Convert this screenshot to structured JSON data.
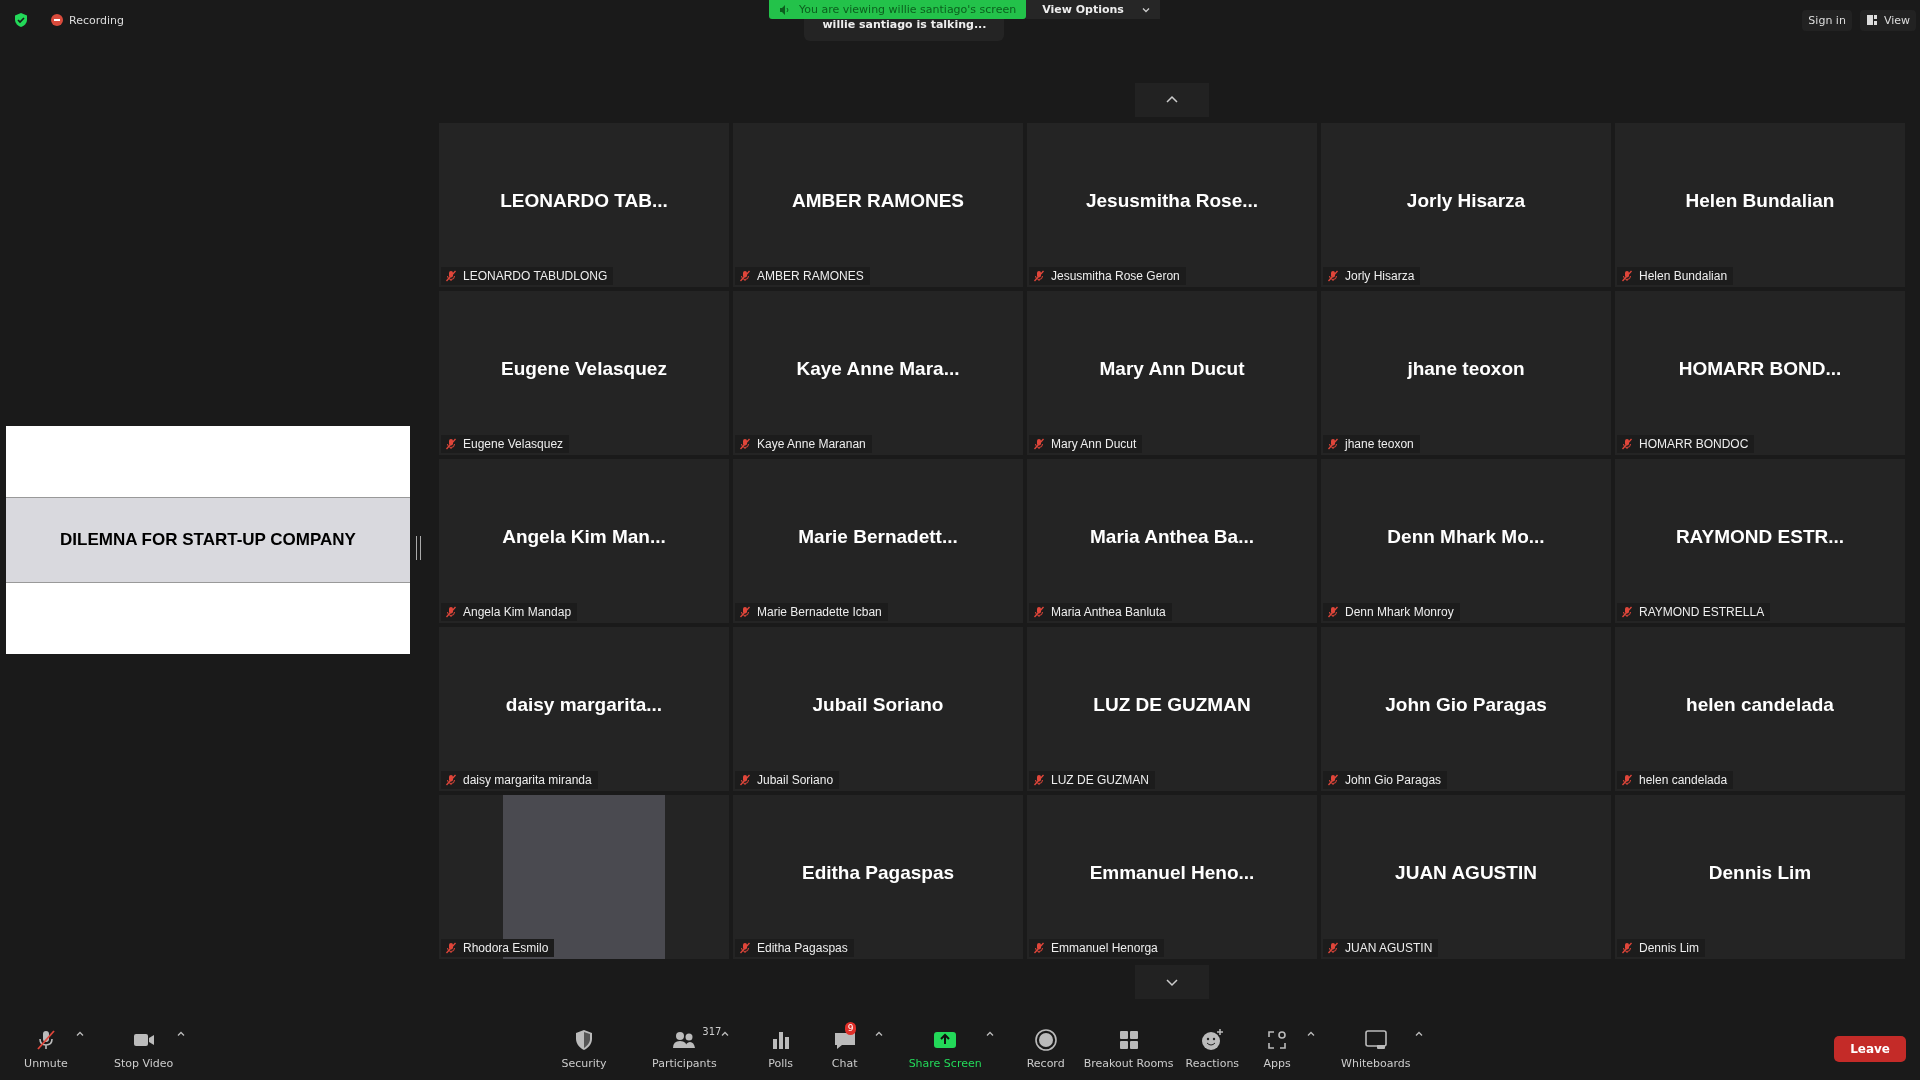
{
  "top_bar": {
    "recording_label": "Recording",
    "banner": "You are viewing willie santiago's screen",
    "view_options": "View Options",
    "talking": "willie santiago is talking...",
    "sign_in": "Sign in",
    "view": "View"
  },
  "shared_screen": {
    "title": "DILEMNA FOR START-UP COMPANY"
  },
  "tile_rows": [
    {
      "tiles": [
        {
          "kind": "name",
          "display": "LEONARDO TAB...",
          "label": "LEONARDO TABUDLONG",
          "muted": true
        },
        {
          "kind": "name",
          "display": "AMBER RAMONES",
          "label": "AMBER RAMONES",
          "muted": true
        },
        {
          "kind": "name",
          "display": "Jesusmitha Rose...",
          "label": "Jesusmitha Rose Geron",
          "muted": true
        },
        {
          "kind": "name",
          "display": "Jorly Hisarza",
          "label": "Jorly Hisarza",
          "muted": true
        },
        {
          "kind": "name",
          "display": "Helen Bundalian",
          "label": "Helen Bundalian",
          "muted": true
        }
      ]
    },
    {
      "tiles": [
        {
          "kind": "name",
          "display": "Eugene Velasquez",
          "label": "Eugene Velasquez",
          "muted": true
        },
        {
          "kind": "name",
          "display": "Kaye Anne Mara...",
          "label": "Kaye Anne Maranan",
          "muted": true
        },
        {
          "kind": "name",
          "display": "Mary Ann Ducut",
          "label": "Mary Ann Ducut",
          "muted": true
        },
        {
          "kind": "name",
          "display": "jhane teoxon",
          "label": "jhane teoxon",
          "muted": true
        },
        {
          "kind": "name",
          "display": "HOMARR BOND...",
          "label": "HOMARR BONDOC",
          "muted": true
        }
      ]
    },
    {
      "tiles": [
        {
          "kind": "name",
          "display": "Angela Kim Man...",
          "label": "Angela Kim Mandap",
          "muted": true
        },
        {
          "kind": "name",
          "display": "Marie Bernadett...",
          "label": "Marie Bernadette Icban",
          "muted": true
        },
        {
          "kind": "name",
          "display": "Maria Anthea Ba...",
          "label": "Maria Anthea Banluta",
          "muted": true
        },
        {
          "kind": "name",
          "display": "Denn Mhark Mo...",
          "label": "Denn Mhark Monroy",
          "muted": true
        },
        {
          "kind": "name",
          "display": "RAYMOND ESTR...",
          "label": "RAYMOND ESTRELLA",
          "muted": true
        }
      ]
    },
    {
      "tiles": [
        {
          "kind": "name",
          "display": "daisy margarita...",
          "label": "daisy margarita miranda",
          "muted": true
        },
        {
          "kind": "name",
          "display": "Jubail Soriano",
          "label": "Jubail Soriano",
          "muted": true
        },
        {
          "kind": "name",
          "display": "LUZ DE GUZMAN",
          "label": "LUZ DE GUZMAN",
          "muted": true
        },
        {
          "kind": "name",
          "display": "John Gio Paragas",
          "label": "John Gio Paragas",
          "muted": true
        },
        {
          "kind": "name",
          "display": "helen candelada",
          "label": "helen candelada",
          "muted": true
        }
      ]
    },
    {
      "tiles": [
        {
          "kind": "video",
          "label": "Rhodora Esmilo",
          "muted": true
        },
        {
          "kind": "name",
          "display": "Editha Pagaspas",
          "label": "Editha Pagaspas",
          "muted": true
        },
        {
          "kind": "name",
          "display": "Emmanuel Heno...",
          "label": "Emmanuel Henorga",
          "muted": true
        },
        {
          "kind": "name",
          "display": "JUAN AGUSTIN",
          "label": "JUAN AGUSTIN",
          "muted": true
        },
        {
          "kind": "name",
          "display": "Dennis Lim",
          "label": "Dennis Lim",
          "muted": true
        }
      ]
    }
  ],
  "toolbar": {
    "left": [
      {
        "kind": "mic",
        "label": "Unmute",
        "menu": true
      },
      {
        "kind": "video",
        "label": "Stop Video",
        "menu": true
      }
    ],
    "center": [
      {
        "kind": "security",
        "label": "Security",
        "menu": false
      },
      {
        "kind": "participants",
        "label": "Participants",
        "count": "317",
        "menu": true
      },
      {
        "kind": "polls",
        "label": "Polls",
        "menu": false
      },
      {
        "kind": "chat",
        "label": "Chat",
        "badge": "9",
        "menu": true
      },
      {
        "kind": "share",
        "label": "Share Screen",
        "menu": true
      },
      {
        "kind": "record",
        "label": "Record",
        "menu": false
      },
      {
        "kind": "breakout",
        "label": "Breakout Rooms",
        "menu": false
      },
      {
        "kind": "reactions",
        "label": "Reactions",
        "menu": false
      },
      {
        "kind": "apps",
        "label": "Apps",
        "menu": true
      },
      {
        "kind": "whiteboards",
        "label": "Whiteboards",
        "menu": true
      }
    ],
    "leave": "Leave"
  }
}
